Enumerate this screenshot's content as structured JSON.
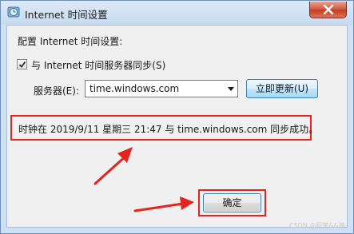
{
  "window": {
    "title": "Internet 时间设置",
    "icon": "clock-globe-icon"
  },
  "section_label": "配置 Internet 时间设置:",
  "sync_checkbox": {
    "checked": true,
    "label": "与 Internet 时间服务器同步(S)"
  },
  "server": {
    "label": "服务器(E):",
    "value": "time.windows.com"
  },
  "update_button": "立即更新(U)",
  "status_message": "时钟在 2019/9/11 星期三 21:47 与 time.windows.com 同步成功。",
  "ok_button": "确定",
  "watermark": "CSDN @招笑&&猿",
  "annotations": {
    "highlight_color": "#e4241f"
  }
}
